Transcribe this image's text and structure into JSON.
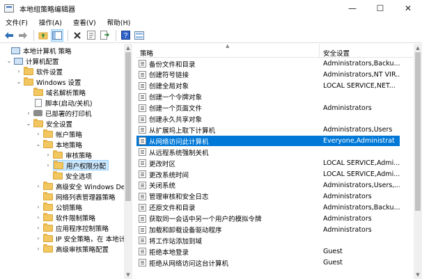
{
  "window": {
    "title": "本地组策略编辑器",
    "controls": [
      "—",
      "☐",
      "✕"
    ]
  },
  "menu": [
    "文件(F)",
    "操作(A)",
    "查看(V)",
    "帮助(H)"
  ],
  "toolbar": [
    "back-icon",
    "forward-icon",
    "up-icon",
    "show-tree-icon",
    "delete-icon",
    "properties-icon",
    "export-icon",
    "help-icon",
    "view-icon"
  ],
  "tree": {
    "items": [
      {
        "label": "本地计算机 策略",
        "icon": "pc",
        "chevron": ""
      },
      {
        "label": "计算机配置",
        "icon": "pc",
        "chevron": "⌄"
      },
      {
        "label": "软件设置",
        "icon": "folder",
        "chevron": "›"
      },
      {
        "label": "Windows 设置",
        "icon": "folder",
        "chevron": "⌄"
      },
      {
        "label": "域名解析策略",
        "icon": "folder",
        "chevron": ""
      },
      {
        "label": "脚本(启动/关机)",
        "icon": "doc",
        "chevron": ""
      },
      {
        "label": "已部署的打印机",
        "icon": "printer",
        "chevron": "›"
      },
      {
        "label": "安全设置",
        "icon": "folder",
        "chevron": "⌄"
      },
      {
        "label": "帐户策略",
        "icon": "folder",
        "chevron": "›"
      },
      {
        "label": "本地策略",
        "icon": "folder",
        "chevron": "⌄"
      },
      {
        "label": "审核策略",
        "icon": "folder",
        "chevron": "›"
      },
      {
        "label": "用户权限分配",
        "icon": "folder",
        "chevron": "›"
      },
      {
        "label": "安全选项",
        "icon": "folder",
        "chevron": ""
      },
      {
        "label": "高级安全 Windows Defe",
        "icon": "folder",
        "chevron": "›"
      },
      {
        "label": "网络列表管理器策略",
        "icon": "folder",
        "chevron": ""
      },
      {
        "label": "公钥策略",
        "icon": "folder",
        "chevron": "›"
      },
      {
        "label": "软件限制策略",
        "icon": "folder",
        "chevron": "›"
      },
      {
        "label": "应用程序控制策略",
        "icon": "folder",
        "chevron": "›"
      },
      {
        "label": "IP 安全策略，在 本地计",
        "icon": "folder",
        "chevron": "›"
      },
      {
        "label": "高级审核策略配置",
        "icon": "folder",
        "chevron": "›"
      }
    ],
    "selected_index": 11
  },
  "list": {
    "columns": [
      "策略",
      "安全设置"
    ],
    "rows": [
      {
        "policy": "备份文件和目录",
        "setting": "Administrators,Backu..."
      },
      {
        "policy": "创建符号链接",
        "setting": "Administrators,NT VIR..."
      },
      {
        "policy": "创建全局对象",
        "setting": "LOCAL SERVICE,NET..."
      },
      {
        "policy": "创建一个令牌对象",
        "setting": ""
      },
      {
        "policy": "创建一个页面文件",
        "setting": "Administrators"
      },
      {
        "policy": "创建永久共享对象",
        "setting": ""
      },
      {
        "policy": "从扩展坞上取下计算机",
        "setting": "Administrators,Users"
      },
      {
        "policy": "从网络访问此计算机",
        "setting": "Everyone,Administrat"
      },
      {
        "policy": "从远程系统强制关机",
        "setting": ""
      },
      {
        "policy": "更改时区",
        "setting": "LOCAL SERVICE,Admi..."
      },
      {
        "policy": "更改系统时间",
        "setting": "LOCAL SERVICE,Admi..."
      },
      {
        "policy": "关闭系统",
        "setting": "Administrators,Users,..."
      },
      {
        "policy": "管理审核和安全日志",
        "setting": "Administrators"
      },
      {
        "policy": "还原文件和目录",
        "setting": "Administrators,Backu..."
      },
      {
        "policy": "获取同一会话中另一个用户的模拟令牌",
        "setting": "Administrators"
      },
      {
        "policy": "加载和卸载设备驱动程序",
        "setting": "Administrators"
      },
      {
        "policy": "将工作站添加到域",
        "setting": ""
      },
      {
        "policy": "拒绝本地登录",
        "setting": "Guest"
      },
      {
        "policy": "拒绝从网络访问这台计算机",
        "setting": "Guest"
      }
    ],
    "selected_index": 7
  },
  "colors": {
    "selection": "#0078d7",
    "tree_selection": "#cce8ff",
    "folder": "#f3c760"
  }
}
